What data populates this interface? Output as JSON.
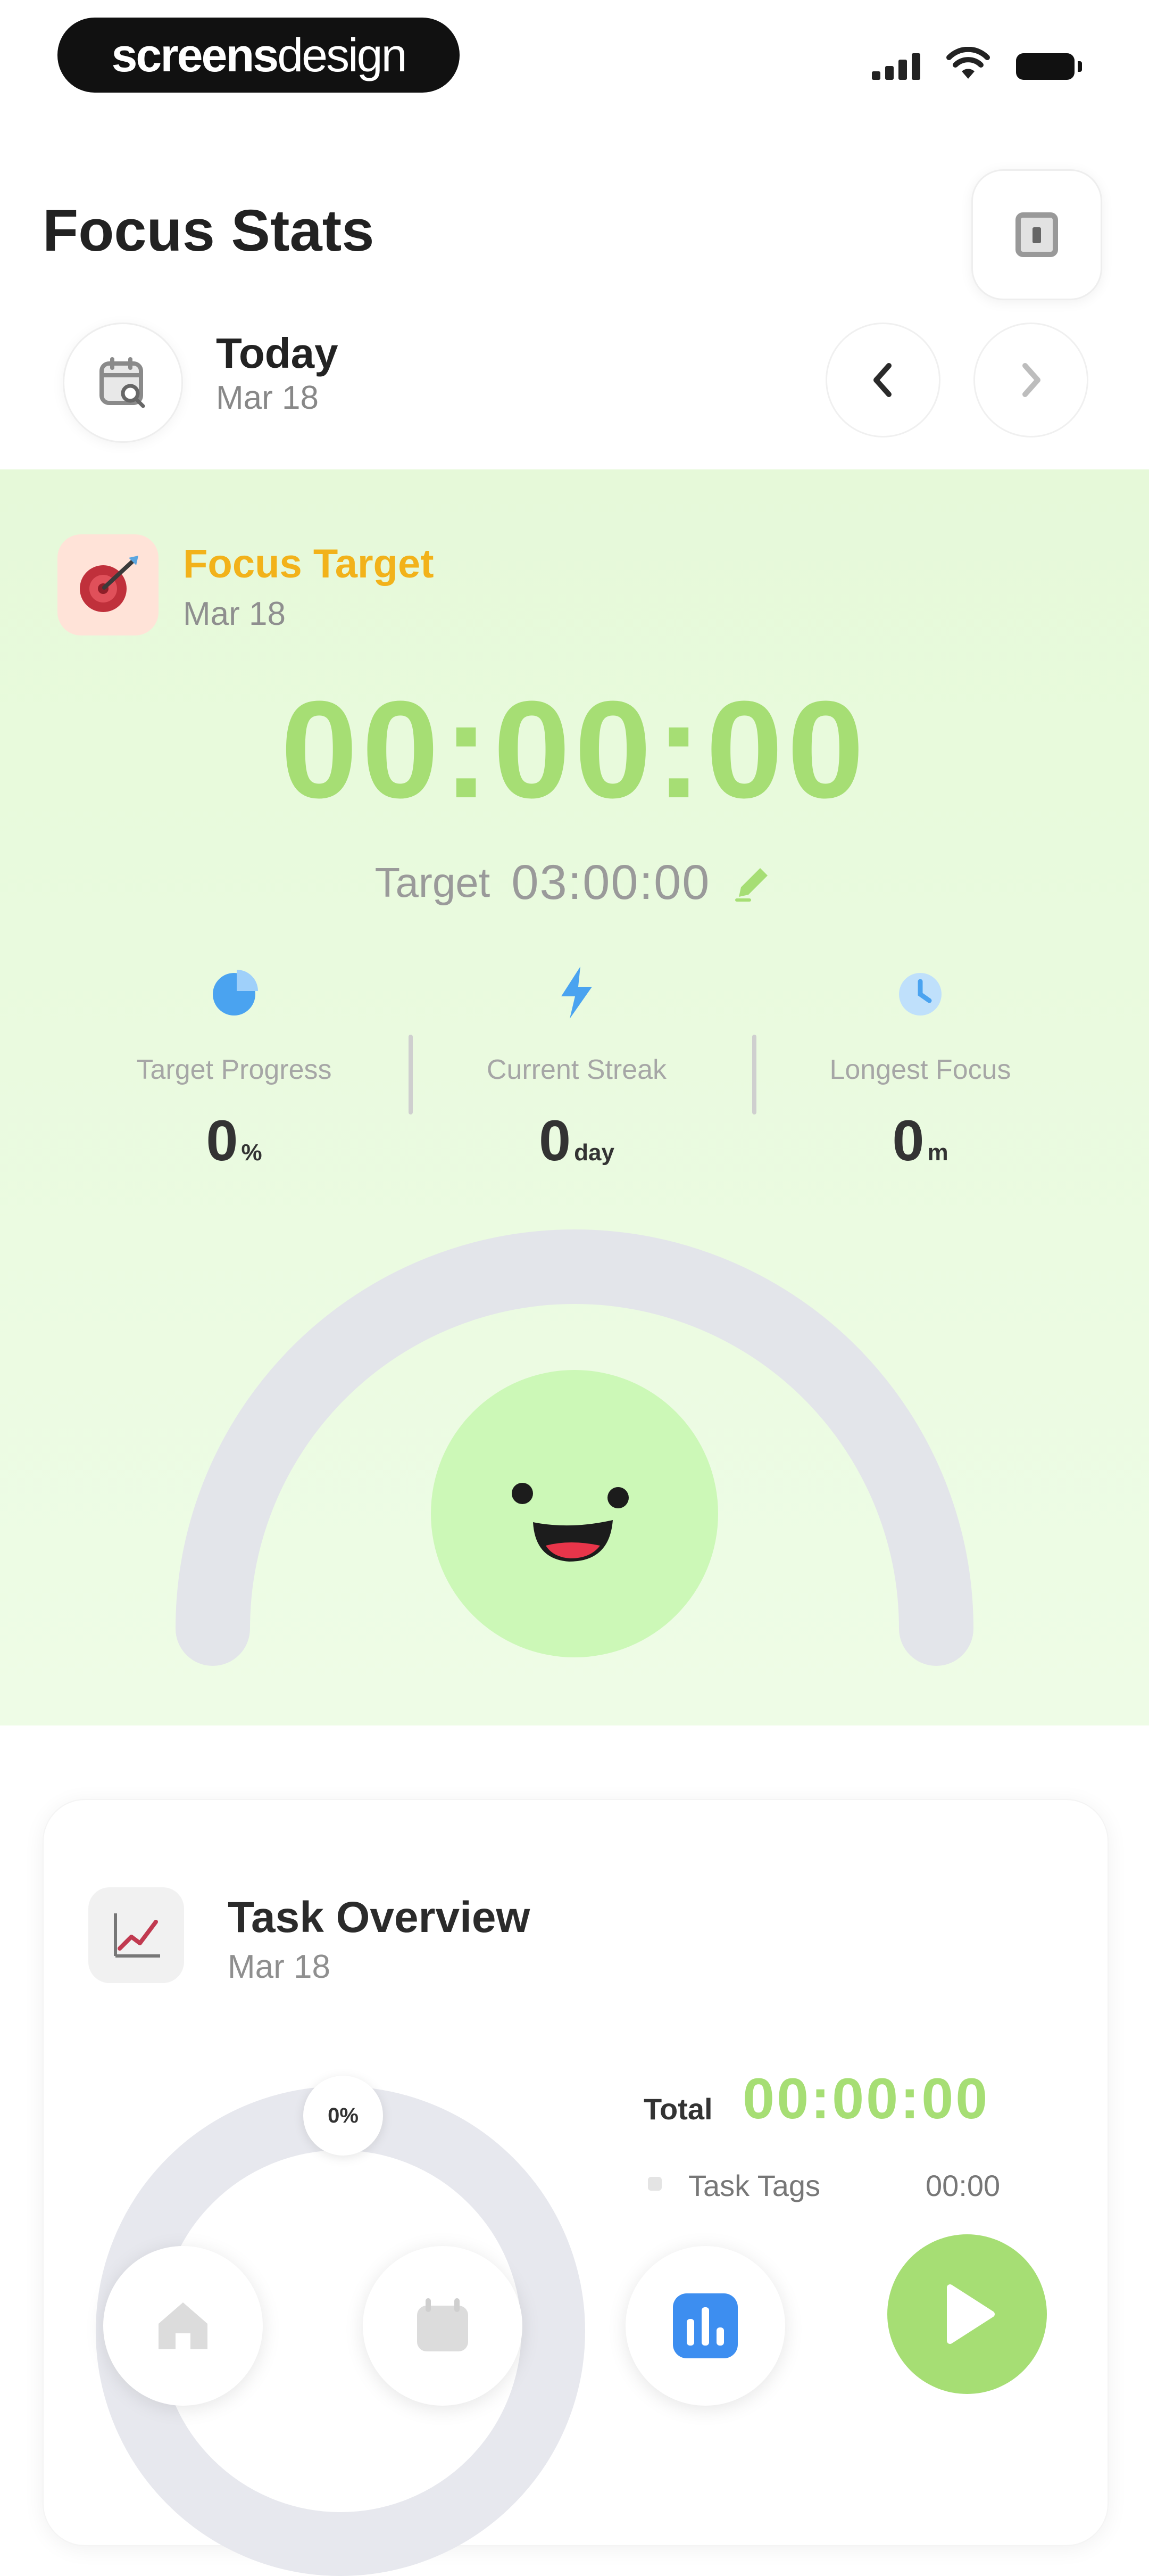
{
  "status_bar": {
    "brand_part1": "screens",
    "brand_part2": "design"
  },
  "header": {
    "title": "Focus Stats"
  },
  "date_nav": {
    "title": "Today",
    "date": "Mar 18"
  },
  "focus": {
    "title": "Focus Target",
    "date": "Mar 18",
    "timer": "00:00:00",
    "target_label": "Target",
    "target_value": "03:00:00",
    "stats": [
      {
        "label": "Target Progress",
        "value": "0",
        "unit": "%",
        "icon": "pie-chart-icon"
      },
      {
        "label": "Current Streak",
        "value": "0",
        "unit": "day",
        "icon": "lightning-icon"
      },
      {
        "label": "Longest Focus",
        "value": "0",
        "unit": "m",
        "icon": "clock-icon"
      }
    ],
    "progress_fraction": 0
  },
  "task_overview": {
    "title": "Task Overview",
    "date": "Mar 18",
    "percent": "0%",
    "total_label": "Total",
    "total_value": "00:00:00",
    "tag_label": "Task Tags",
    "tag_time": "00:00"
  },
  "colors": {
    "accent_green": "#a6de74",
    "focus_bg": "#e6f9d9",
    "target_orange": "#f2b21a",
    "stat_blue": "#4aa3f0",
    "active_nav_blue": "#3d8ef0"
  },
  "bottom_nav": [
    "home-icon",
    "calendar-icon",
    "stats-icon",
    "play-icon"
  ]
}
